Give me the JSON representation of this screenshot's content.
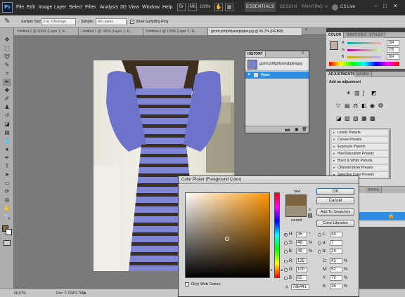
{
  "menu": {
    "items": [
      "File",
      "Edit",
      "Image",
      "Layer",
      "Select",
      "Filter",
      "Analysis",
      "3D",
      "View",
      "Window",
      "Help"
    ],
    "zoom": "100%",
    "workspaces": [
      "ESSENTIALS",
      "DESIGN",
      "PAINTING"
    ],
    "cs_live": "CS Live"
  },
  "options": {
    "sample_size_label": "Sample Size:",
    "sample_size_value": "3 by 3 Average",
    "sample_label": "Sample:",
    "sample_value": "All Layers",
    "show_ring": "Show Sampling Ring"
  },
  "doc_tabs": [
    "Untitled-1 @ 100% (Layer 1, R...",
    "Untitled-1 @ 100% (Layer 1, R...",
    "Untitled-2 @ 100% (Layer 1, R...",
    "gcmrcydrfpdfyamqbpbw.jpg @ 66.7% (RGB/8)"
  ],
  "history": {
    "title": "HISTORY",
    "snapshot": "gcmrcydrfpdfyamqbpbw.jpg",
    "step": "Open"
  },
  "color_panel": {
    "tabs": [
      "COLOR",
      "SWATCHES",
      "STYLES"
    ],
    "r": "194",
    "g": "175",
    "b": "164"
  },
  "adjustments": {
    "tabs": [
      "ADJUSTMENTS",
      "MASKS"
    ],
    "heading": "Add an adjustment",
    "presets": [
      "Levels Presets",
      "Curves Presets",
      "Exposure Presets",
      "Hue/Saturation Presets",
      "Black & White Presets",
      "Channel Mixer Presets",
      "Selective Color Presets"
    ]
  },
  "paths_tab": "PATHS",
  "status": {
    "zoom": "66.67%",
    "doc": "Doc: 1.76M/1.76M"
  },
  "picker": {
    "title": "Color Picker (Foreground Color)",
    "ok": "OK",
    "cancel": "Cancel",
    "add_swatches": "Add To Swatches",
    "libraries": "Color Libraries",
    "new_label": "new",
    "current_label": "current",
    "only_web": "Only Web Colors",
    "hex_label": "#",
    "hex": "7d6441",
    "fields": {
      "H": "35",
      "H_unit": "°",
      "S": "48",
      "S_unit": "%",
      "B": "49",
      "B_unit": "%",
      "R": "125",
      "G": "100",
      "Bv": "65",
      "L": "44",
      "a": "7",
      "b": "24",
      "C": "43",
      "M": "52",
      "Y": "79",
      "K": "25",
      "pct": "%"
    }
  },
  "colors": {
    "new_swatch": "#7d6441",
    "current_swatch": "#9c927a",
    "accent": "#2f8ce0"
  }
}
